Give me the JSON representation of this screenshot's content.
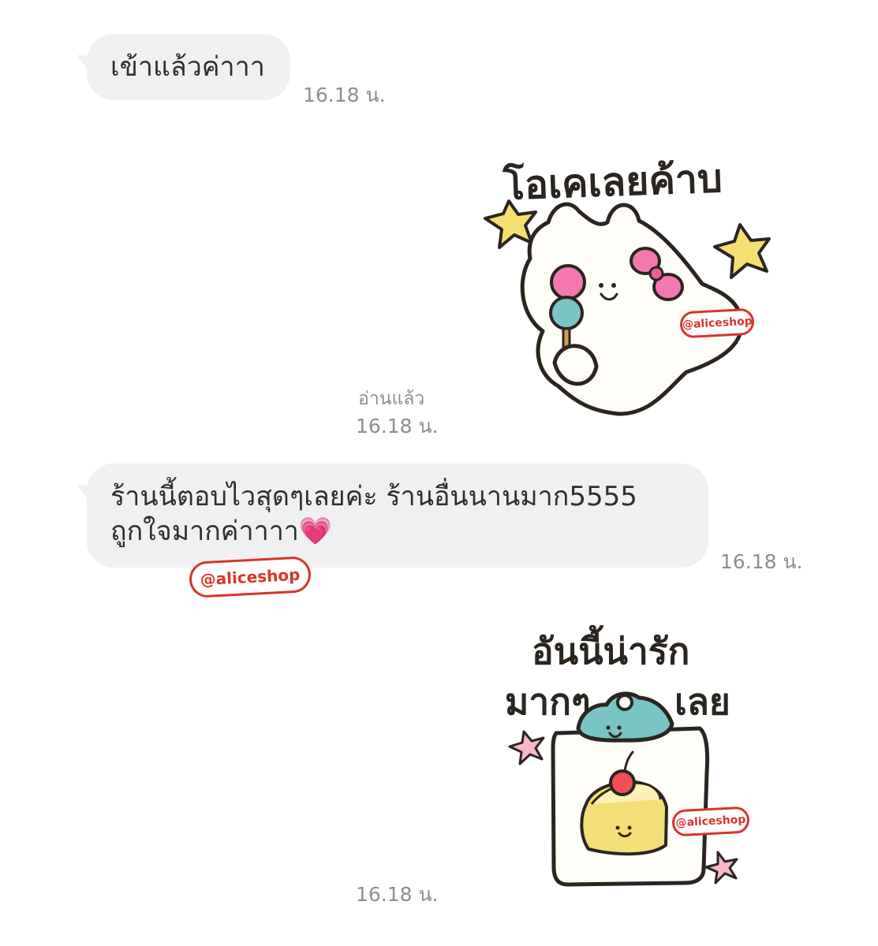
{
  "messages": [
    {
      "type": "text",
      "text": "เข้าแล้วค่าาา",
      "time": "16.18 น."
    },
    {
      "type": "sticker",
      "text": "โอเคเลยค้าบ",
      "read": "อ่านแล้ว",
      "time": "16.18 น.",
      "watermark": "@aliceshop"
    },
    {
      "type": "text",
      "line1": "ร้านนี้ตอบไวสุดๆเลยค่ะ ร้านอื่นนานมาก5555",
      "line2": "ถูกใจมากค่าาาา",
      "emoji": "💗",
      "time": "16.18 น.",
      "watermark": "@aliceshop"
    },
    {
      "type": "sticker",
      "line1": "อันนี้น่ารัก",
      "line2_a": "มากๆ",
      "line2_b": "เลย",
      "time": "16.18 น.",
      "watermark": "@aliceshop"
    }
  ],
  "colors": {
    "bubble": "#eff0f2",
    "meta": "#8a8f96",
    "watermark": "#d9342b",
    "star": "#f6df72",
    "pink": "#f478b0",
    "teal": "#79c4c5",
    "yellow": "#f4de77"
  },
  "icons": [
    "star-icon",
    "sparkle-icon",
    "heart-emoji"
  ]
}
